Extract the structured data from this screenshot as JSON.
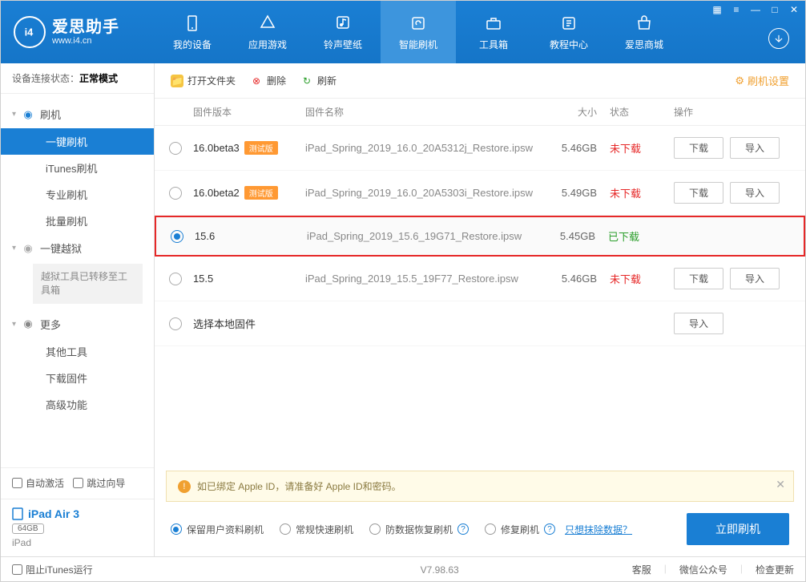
{
  "app": {
    "name": "爱思助手",
    "url": "www.i4.cn"
  },
  "nav": [
    {
      "label": "我的设备",
      "icon": "phone"
    },
    {
      "label": "应用游戏",
      "icon": "app"
    },
    {
      "label": "铃声壁纸",
      "icon": "music"
    },
    {
      "label": "智能刷机",
      "icon": "refresh",
      "active": true
    },
    {
      "label": "工具箱",
      "icon": "toolbox"
    },
    {
      "label": "教程中心",
      "icon": "book"
    },
    {
      "label": "爱思商城",
      "icon": "shop"
    }
  ],
  "sidebar": {
    "status_label": "设备连接状态：",
    "status_value": "正常模式",
    "sections": [
      {
        "label": "刷机",
        "icon": "flash",
        "color": "#1a7fd4",
        "items": [
          {
            "label": "一键刷机",
            "active": true
          },
          {
            "label": "iTunes刷机"
          },
          {
            "label": "专业刷机"
          },
          {
            "label": "批量刷机"
          }
        ]
      },
      {
        "label": "一键越狱",
        "icon": "lock",
        "color": "#aaa",
        "note": "越狱工具已转移至工具箱"
      },
      {
        "label": "更多",
        "icon": "more",
        "color": "#888",
        "items": [
          {
            "label": "其他工具"
          },
          {
            "label": "下载固件"
          },
          {
            "label": "高级功能"
          }
        ]
      }
    ],
    "auto_activate": "自动激活",
    "skip_guide": "跳过向导",
    "device": {
      "name": "iPad Air 3",
      "capacity": "64GB",
      "type": "iPad"
    }
  },
  "toolbar": {
    "open": "打开文件夹",
    "delete": "删除",
    "refresh": "刷新",
    "settings": "刷机设置"
  },
  "columns": {
    "version": "固件版本",
    "name": "固件名称",
    "size": "大小",
    "status": "状态",
    "action": "操作"
  },
  "firmware": [
    {
      "version": "16.0beta3",
      "beta": "测试版",
      "name": "iPad_Spring_2019_16.0_20A5312j_Restore.ipsw",
      "size": "5.46GB",
      "status": "未下载",
      "downloaded": false,
      "selected": false
    },
    {
      "version": "16.0beta2",
      "beta": "测试版",
      "name": "iPad_Spring_2019_16.0_20A5303i_Restore.ipsw",
      "size": "5.49GB",
      "status": "未下载",
      "downloaded": false,
      "selected": false
    },
    {
      "version": "15.6",
      "name": "iPad_Spring_2019_15.6_19G71_Restore.ipsw",
      "size": "5.45GB",
      "status": "已下载",
      "downloaded": true,
      "selected": true,
      "highlight": true
    },
    {
      "version": "15.5",
      "name": "iPad_Spring_2019_15.5_19F77_Restore.ipsw",
      "size": "5.46GB",
      "status": "未下载",
      "downloaded": false,
      "selected": false
    }
  ],
  "local_fw_label": "选择本地固件",
  "buttons": {
    "download": "下载",
    "import": "导入"
  },
  "notice": "如已绑定 Apple ID，请准备好 Apple ID和密码。",
  "options": {
    "keep_data": "保留用户资料刷机",
    "normal": "常规快速刷机",
    "anti_recover": "防数据恢复刷机",
    "repair": "修复刷机",
    "erase_only": "只想抹除数据？",
    "flash_now": "立即刷机"
  },
  "footer": {
    "block_itunes": "阻止iTunes运行",
    "version": "V7.98.63",
    "support": "客服",
    "wechat": "微信公众号",
    "update": "检查更新"
  }
}
